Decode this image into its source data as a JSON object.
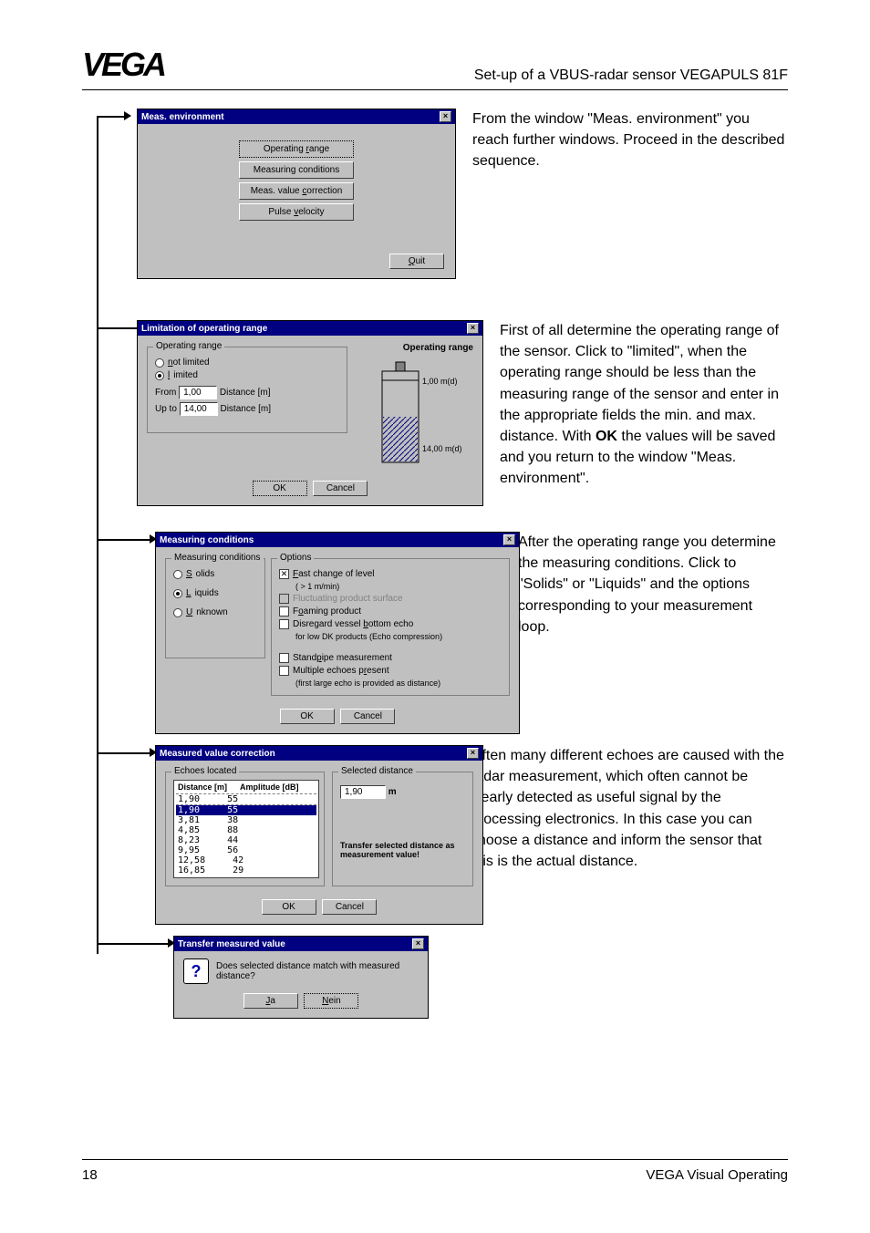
{
  "header": {
    "logo": "VEGA",
    "title": "Set-up of a VBUS-radar sensor VEGAPULS 81F"
  },
  "meas_env": {
    "title": "Meas. environment",
    "buttons": {
      "operating_range": "Operating range",
      "measuring_conditions": "Measuring conditions",
      "meas_value_correction": "Meas. value correction",
      "pulse_velocity": "Pulse velocity",
      "quit": "Quit"
    },
    "desc": "From the window \"Meas. environment\" you reach further windows. Proceed in the described sequence."
  },
  "op_range": {
    "title": "Limitation of operating range",
    "group_label": "Operating range",
    "radio_not_limited": "not limited",
    "radio_limited": "limited",
    "from_label": "From",
    "upto_label": "Up to",
    "dist_label": "Distance [m]",
    "from_value": "1,00",
    "upto_value": "14,00",
    "right_label": "Operating range",
    "top_reading": "1,00 m(d)",
    "bottom_reading": "14,00 m(d)",
    "ok": "OK",
    "cancel": "Cancel",
    "desc_a": "First of all determine the operating range of the sensor. Click to \"limited\", when the operating range should be less than the measuring range of the sensor and enter in the appropriate fields the min. and max. distance. With ",
    "desc_bold": "OK",
    "desc_b": " the values will be saved and you return to the window \"Meas. environment\"."
  },
  "meas_cond": {
    "title": "Measuring conditions",
    "group_cond": "Measuring conditions",
    "radio_solids": "Solids",
    "radio_liquids": "Liquids",
    "radio_unknown": "Unknown",
    "group_opts": "Options",
    "opt_fast": "Fast change of level",
    "opt_fast_sub": "( > 1 m/min)",
    "opt_fluct": "Fluctuating product surface",
    "opt_foam": "Foaming product",
    "opt_disregard": "Disregard vessel bottom echo",
    "opt_disregard_sub": "for low DK products (Echo compression)",
    "opt_standpipe": "Standpipe measurement",
    "opt_multi": "Multiple echoes present",
    "opt_multi_sub": "(first large echo is provided as distance)",
    "ok": "OK",
    "cancel": "Cancel",
    "desc": "After the operating range you determine the measuring conditions. Click to  \"Solids\" or \"Liquids\" and the options corresponding to your measurement loop."
  },
  "mv_corr": {
    "title": "Measured value correction",
    "group_echoes": "Echoes located",
    "col_dist": "Distance [m]",
    "col_amp": "Amplitude [dB]",
    "rows": [
      {
        "d": "1,90",
        "a": "55"
      },
      {
        "d": "1,90",
        "a": "55"
      },
      {
        "d": "3,81",
        "a": "38"
      },
      {
        "d": "4,85",
        "a": "88"
      },
      {
        "d": "8,23",
        "a": "44"
      },
      {
        "d": "9,95",
        "a": "56"
      },
      {
        "d": "12,58",
        "a": "42"
      },
      {
        "d": "16,85",
        "a": "29"
      }
    ],
    "group_sel": "Selected distance",
    "sel_value": "1,90",
    "sel_unit": "m",
    "transfer_note": "Transfer selected distance as measurement value!",
    "ok": "OK",
    "cancel": "Cancel",
    "desc": "Often many different echoes are caused with the radar measurement, which often cannot be clearly detected as useful signal by the processing electronics. In this case you can choose a distance and inform the sensor that this is the actual distance."
  },
  "transfer": {
    "title": "Transfer measured value",
    "question": "Does selected distance match with measured distance?",
    "yes": "Ja",
    "no": "Nein"
  },
  "footer": {
    "page": "18",
    "right": "VEGA Visual Operating"
  }
}
